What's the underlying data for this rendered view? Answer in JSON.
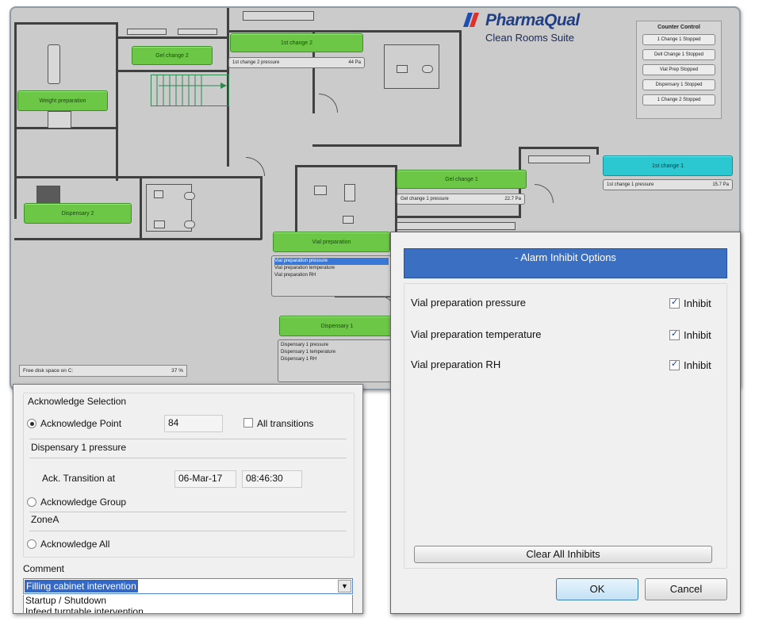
{
  "brand": {
    "name": "PharmaQual",
    "subtitle": "Clean Rooms Suite"
  },
  "counter_control": {
    "title": "Counter Control",
    "items": [
      "1 Change 1 Stopped",
      "Dell Change 1 Stopped",
      "Vial Prep Stopped",
      "Dispensary 1 Stopped",
      "1 Change 2 Stopped"
    ]
  },
  "rooms": {
    "gel_change_2": "Gel change 2",
    "first_change_2": "1st change 2",
    "first_change_2_pressure": {
      "label": "1st change 2 pressure",
      "value": "44 Pa"
    },
    "weight_preparation": "Weight preparation",
    "dispensary_2": "Dispensary 2",
    "gel_change_1": "Gel change 1",
    "gel_change_1_pressure": {
      "label": "Gel change 1 pressure",
      "value": "22.7 Pa"
    },
    "first_change_1": "1st change 1",
    "first_change_1_pressure": {
      "label": "1st change 1 pressure",
      "value": "15.7 Pa"
    },
    "vial_preparation": "Vial preparation",
    "vial_preparation_points": [
      "Vial preparation pressure",
      "Vial preparation temperature",
      "Vial preparation RH"
    ],
    "dispensary_1": "Dispensary 1",
    "dispensary_1_points": [
      "Dispensary 1 pressure",
      "Dispensary 1 temperature",
      "Dispensary 1 RH"
    ]
  },
  "disk": {
    "label": "Free disk space on C:",
    "value": "37 %"
  },
  "ack": {
    "section_title": "Acknowledge Selection",
    "point_label": "Acknowledge Point",
    "point_value": "84",
    "all_transitions_label": "All transitions",
    "point_name": "Dispensary 1 pressure",
    "transition_label": "Ack. Transition at",
    "transition_date": "06-Mar-17",
    "transition_time": "08:46:30",
    "group_label": "Acknowledge Group",
    "group_value": "ZoneA",
    "all_label": "Acknowledge All",
    "comment_label": "Comment",
    "comment_value": "Filling cabinet intervention",
    "comment_options": [
      "Startup / Shutdown",
      "Infeed turntable intervention"
    ]
  },
  "inhibit": {
    "title": "- Alarm Inhibit Options",
    "rows": [
      {
        "label": "Vial preparation pressure",
        "checkbox": "Inhibit",
        "checked": true
      },
      {
        "label": "Vial preparation temperature",
        "checkbox": "Inhibit",
        "checked": true
      },
      {
        "label": "Vial preparation RH",
        "checkbox": "Inhibit",
        "checked": true
      }
    ],
    "clear_label": "Clear All Inhibits",
    "ok_label": "OK",
    "cancel_label": "Cancel"
  },
  "colors": {
    "room_green": "#6cc746",
    "room_cyan": "#2cc8d2",
    "dialog_title": "#3b6fc2",
    "selection": "#3368c6"
  }
}
